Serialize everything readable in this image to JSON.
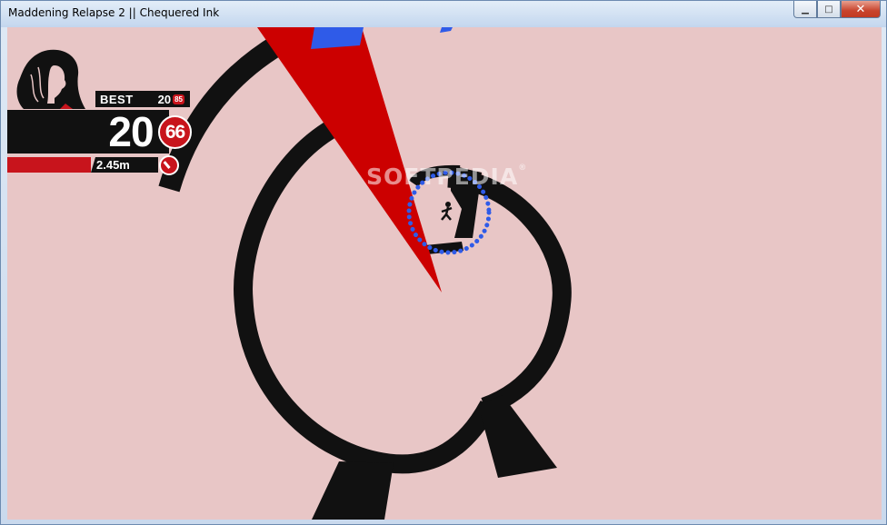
{
  "window": {
    "title": "Maddening Relapse 2 || Chequered Ink",
    "minimize_glyph": "▁",
    "maximize_glyph": "□",
    "close_glyph": "✕"
  },
  "hud": {
    "best_label": "BEST",
    "best_main": "20",
    "best_sub": "85",
    "score_main": "20",
    "score_sub": "66",
    "distance": "2.45m"
  },
  "watermark": {
    "text": "SOFTPEDIA",
    "mark": "®"
  },
  "colors": {
    "background": "#e8c6c6",
    "track": "#111111",
    "hazard_red": "#cc0000",
    "marker_blue": "#2f5be8",
    "hud_red": "#c8141c"
  },
  "icons": {
    "avatar": "woman-silhouette-icon",
    "distance": "speedometer-icon",
    "player": "runner-silhouette-icon"
  }
}
